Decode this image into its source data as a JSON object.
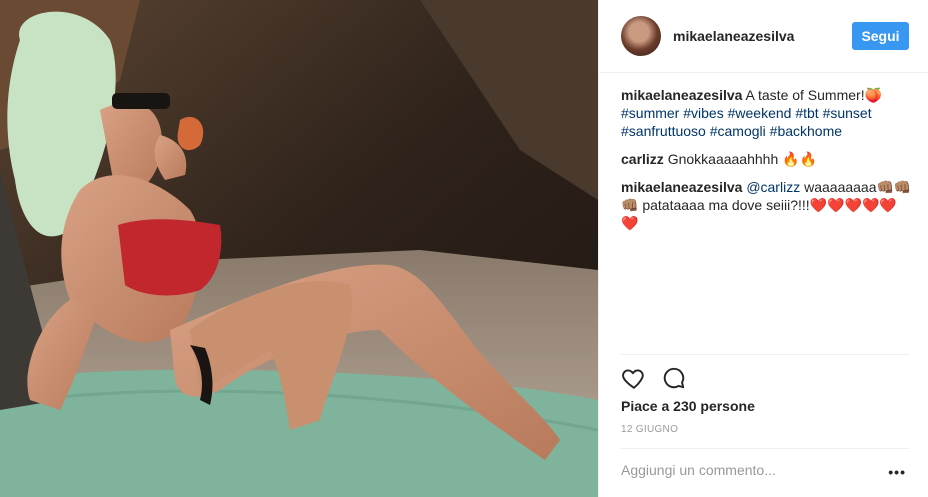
{
  "post": {
    "username": "mikaelaneazesilva",
    "follow_label": "Segui",
    "photo_alt": ""
  },
  "comments": [
    {
      "user": "mikaelaneazesilva",
      "text": "A taste of Summer!🍑",
      "tags": [
        "#summer",
        "#vibes",
        "#weekend",
        "#tbt",
        "#sunset",
        "#sanfruttuoso",
        "#camogli",
        "#backhome"
      ]
    },
    {
      "user": "carlizz",
      "text": "Gnokkaaaaahhhh 🔥🔥"
    },
    {
      "user": "mikaelaneazesilva",
      "mention": "@carlizz",
      "text": "waaaaaaaa👊🏽👊🏽👊🏽 patataaaa ma dove seiii?!!!❤️❤️❤️❤️❤️❤️"
    }
  ],
  "likes_text": "Piace a 230 persone",
  "date_text": "12 GIUGNO",
  "comment_placeholder": "Aggiungi un commento...",
  "more_label": "•••",
  "icons": {
    "like": "heart-icon",
    "comment": "comment-bubble-icon"
  },
  "colors": {
    "follow_button": "#3897f0",
    "hashtag": "#003569"
  }
}
